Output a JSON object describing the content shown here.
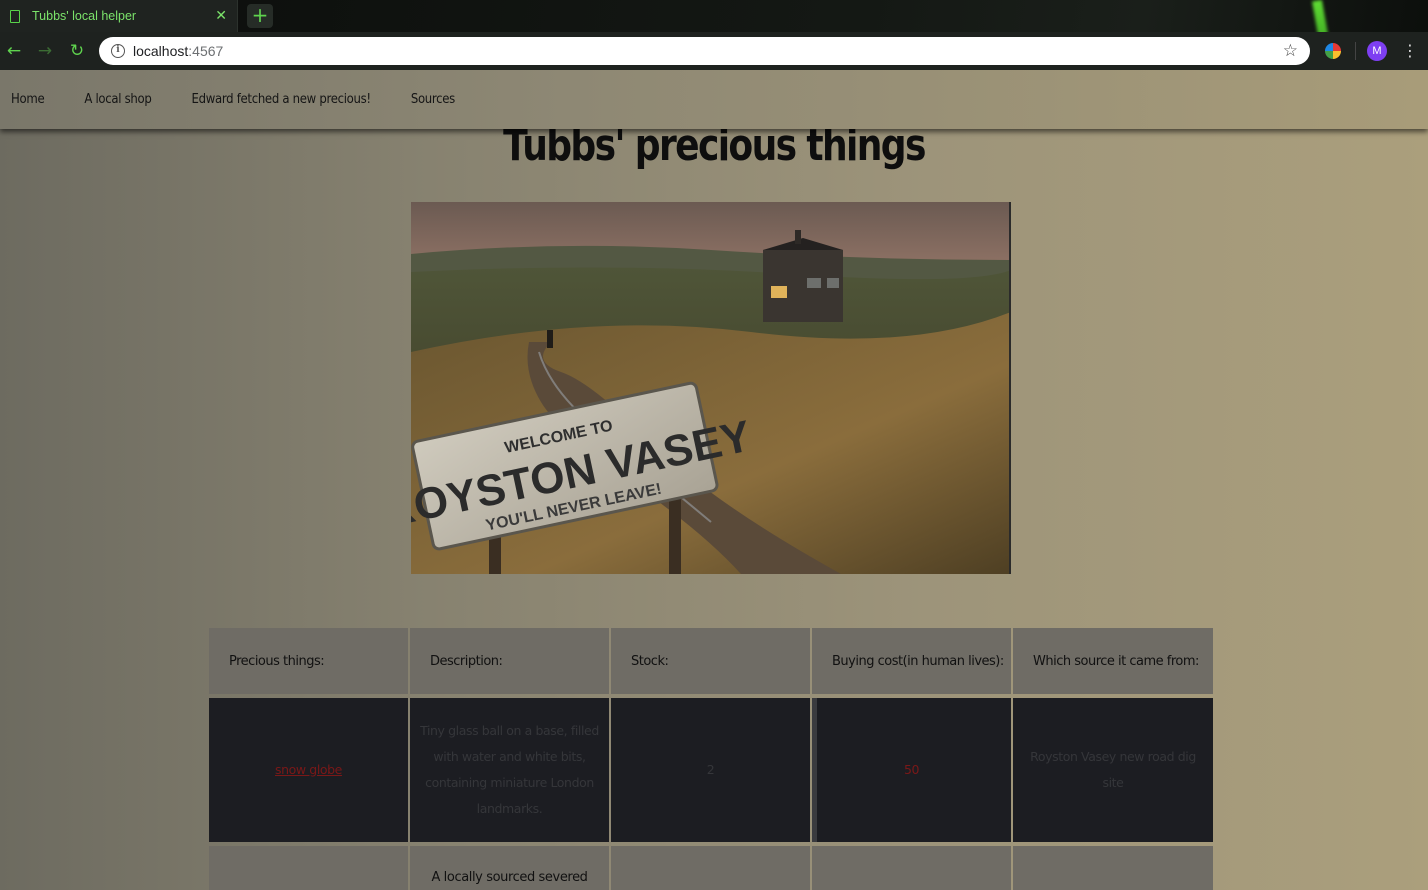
{
  "browser": {
    "tab_title": "Tubbs' local helper",
    "url_host": "localhost",
    "url_port": ":4567",
    "profile_initial": "M"
  },
  "nav": {
    "items": [
      "Home",
      "A local shop",
      "Edward fetched a new precious!",
      "Sources"
    ]
  },
  "page": {
    "title": "Tubbs' precious things",
    "hero_sign": {
      "line1": "WELCOME TO",
      "line2": "ROYSTON VASEY",
      "line3": "YOU'LL NEVER LEAVE!"
    }
  },
  "table": {
    "headers": [
      "Precious things:",
      "Description:",
      "Stock:",
      "Buying cost(in human lives):",
      "Which source it came from:"
    ],
    "rows": [
      {
        "name": "snow globe",
        "description": "Tiny glass ball on a base, filled with water and white bits, containing miniature London landmarks.",
        "stock": "2",
        "cost": "50",
        "source": "Royston Vasey new road dig site"
      },
      {
        "name": "",
        "description": "A locally sourced severed",
        "stock": "",
        "cost": "",
        "source": ""
      }
    ]
  },
  "colors": {
    "tab_text": "#7be36a",
    "link_red": "#7a1818",
    "table_dark": "#1c1d22",
    "table_header": "#6f6c65"
  }
}
